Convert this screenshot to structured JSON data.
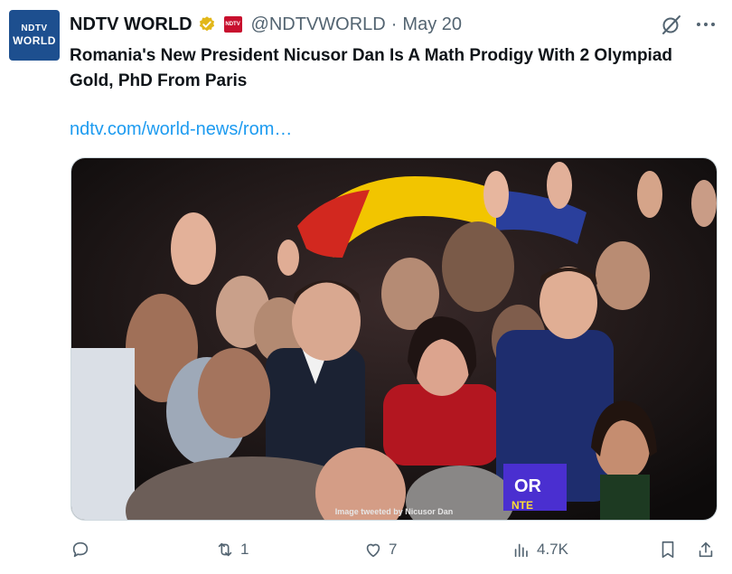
{
  "avatar": {
    "line1": "NDTV",
    "line2": "WORLD"
  },
  "author": {
    "name": "NDTV WORLD",
    "affiliate_badge": "NDTV",
    "handle": "@NDTVWORLD",
    "separator": "·",
    "date": "May 20"
  },
  "tweet": {
    "text": "Romania's New President Nicusor Dan Is A Math Prodigy With 2 Olympiad Gold, PhD From Paris",
    "link": "ndtv.com/world-news/rom…"
  },
  "media": {
    "caption": "Image tweeted by Nicusor Dan",
    "sign_text_1": "OR",
    "sign_text_2": "NTE"
  },
  "actions": {
    "reply_count": "",
    "retweet_count": "1",
    "like_count": "7",
    "views_count": "4.7K"
  },
  "colors": {
    "accent": "#1d9bf0",
    "secondary_text": "#536471",
    "verified_gold": "#e2b719",
    "brand_blue": "#1d4f8f"
  }
}
